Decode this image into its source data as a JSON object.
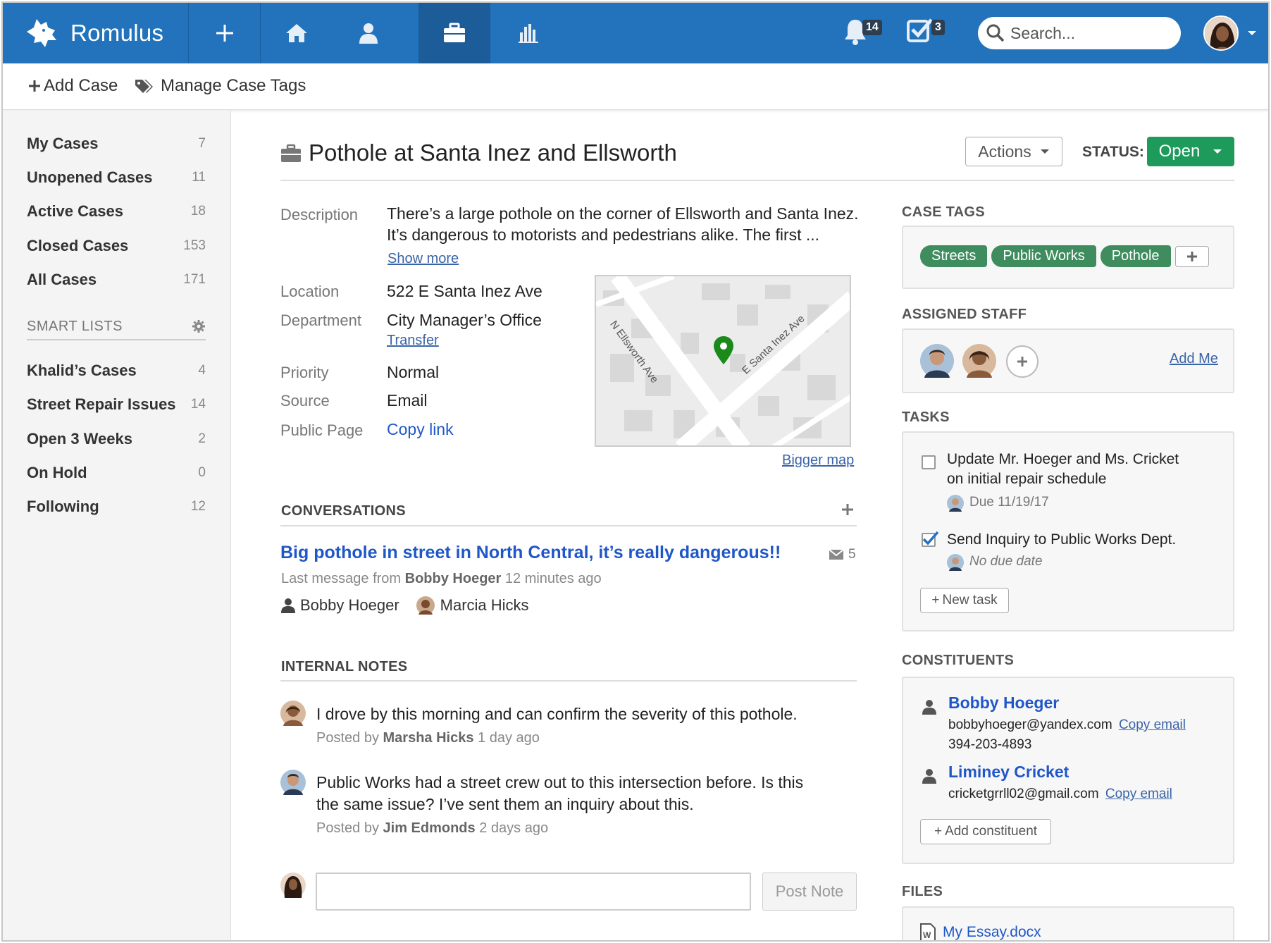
{
  "app": {
    "name": "Romulus"
  },
  "topnav": {
    "notifications_count": "14",
    "tasks_count": "3",
    "search_placeholder": "Search..."
  },
  "subnav": {
    "add_case": "Add Case",
    "manage_tags": "Manage Case Tags"
  },
  "sidebar": {
    "items": [
      {
        "label": "My Cases",
        "count": "7"
      },
      {
        "label": "Unopened Cases",
        "count": "11"
      },
      {
        "label": "Active Cases",
        "count": "18"
      },
      {
        "label": "Closed Cases",
        "count": "153"
      },
      {
        "label": "All Cases",
        "count": "171"
      }
    ],
    "smart_lists_title": "SMART LISTS",
    "smart_lists": [
      {
        "label": "Khalid’s Cases",
        "count": "4"
      },
      {
        "label": "Street Repair Issues",
        "count": "14"
      },
      {
        "label": "Open 3 Weeks",
        "count": "2"
      },
      {
        "label": "On Hold",
        "count": "0"
      },
      {
        "label": "Following",
        "count": "12"
      }
    ]
  },
  "case": {
    "title": "Pothole at Santa Inez and Ellsworth",
    "actions_label": "Actions",
    "status_label": "STATUS:",
    "status_value": "Open",
    "status_color": "#1e9a5b",
    "description_label": "Description",
    "description_line1": "There’s a large pothole on the corner of Ellsworth and Santa Inez.",
    "description_line2": "It’s dangerous to motorists and pedestrians alike.  The first ...",
    "show_more": "Show more",
    "location_label": "Location",
    "location_value": "522 E Santa Inez Ave",
    "department_label": "Department",
    "department_value": "City Manager’s Office",
    "transfer": "Transfer",
    "priority_label": "Priority",
    "priority_value": "Normal",
    "source_label": "Source",
    "source_value": "Email",
    "public_page_label": "Public Page",
    "public_page_value": "Copy link",
    "map": {
      "street1": "N Ellsworth Ave",
      "street2": "E Santa Inez Ave",
      "bigger_map": "Bigger map"
    }
  },
  "conversations": {
    "title": "CONVERSATIONS",
    "thread_title": "Big pothole in street in North Central, it’s really dangerous!!",
    "message_count": "5",
    "last_message_prefix": "Last message from",
    "last_message_author": "Bobby Hoeger",
    "last_message_time": "12 minutes ago",
    "participants": [
      "Bobby Hoeger",
      "Marcia Hicks"
    ]
  },
  "notes": {
    "title": "INTERNAL NOTES",
    "posted_by": "Posted by",
    "items": [
      {
        "text": "I drove by this morning and can confirm the severity of this pothole.",
        "author": "Marsha Hicks",
        "time": "1 day ago"
      },
      {
        "text_line1": "Public Works had a street crew out to this intersection before. Is this",
        "text_line2": "the same issue? I’ve sent them an inquiry about this.",
        "author": "Jim Edmonds",
        "time": "2 days ago"
      }
    ],
    "post_button": "Post Note",
    "input_value": ""
  },
  "right": {
    "case_tags_title": "CASE TAGS",
    "tags": [
      "Streets",
      "Public Works",
      "Pothole"
    ],
    "tag_color": "#3f8d5f",
    "assigned_staff_title": "ASSIGNED STAFF",
    "add_me": "Add Me",
    "tasks_title": "TASKS",
    "tasks": [
      {
        "line1": "Update Mr. Hoeger and Ms. Cricket",
        "line2": "on initial repair schedule",
        "due": "Due 11/19/17",
        "checked": false
      },
      {
        "line1": "Send Inquiry to Public Works Dept.",
        "due": "No due date",
        "checked": true
      }
    ],
    "new_task": "New task",
    "constituents_title": "CONSTITUENTS",
    "constituents": [
      {
        "name": "Bobby Hoeger",
        "email": "bobbyhoeger@yandex.com",
        "phone": "394-203-4893"
      },
      {
        "name": "Liminey Cricket",
        "email": "cricketgrrll02@gmail.com"
      }
    ],
    "copy_email": "Copy email",
    "add_constituent": "Add constituent",
    "files_title": "FILES",
    "files": [
      "My Essay.docx"
    ]
  },
  "icons": {
    "logo": "wolf-logo-icon",
    "plus": "plus-icon",
    "home": "home-icon",
    "person": "person-icon",
    "briefcase": "briefcase-icon",
    "chart": "bar-chart-icon",
    "bell": "bell-icon",
    "checkbox": "checkbox-icon",
    "search": "search-icon",
    "tag": "tag-icon",
    "gear": "gear-icon",
    "envelope": "envelope-icon",
    "pin": "map-pin-icon",
    "doc": "word-doc-icon"
  },
  "colors": {
    "nav_bg": "#2272bc",
    "nav_active": "#1b5c99",
    "link": "#1f57c8",
    "open_green": "#1e9a5b"
  }
}
